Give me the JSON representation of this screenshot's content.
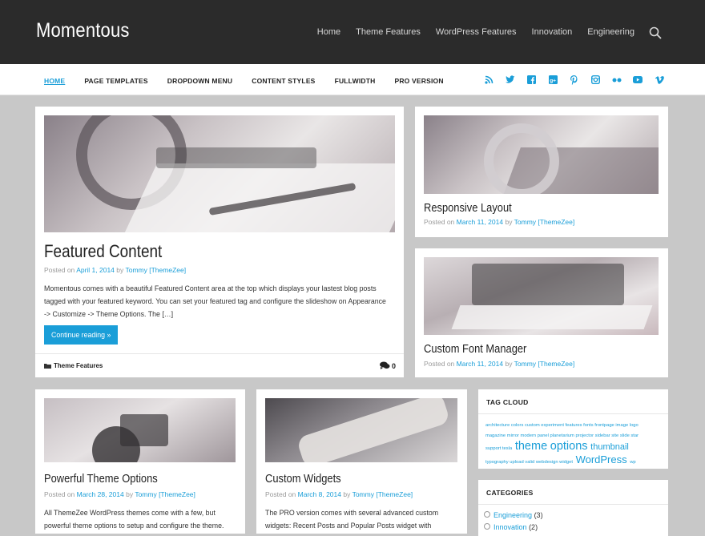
{
  "site": {
    "title": "Momentous"
  },
  "top_nav": [
    "Home",
    "Theme Features",
    "WordPress Features",
    "Innovation",
    "Engineering"
  ],
  "main_nav": [
    "HOME",
    "PAGE TEMPLATES",
    "DROPDOWN MENU",
    "CONTENT STYLES",
    "FULLWIDTH",
    "PRO VERSION"
  ],
  "social_icons": [
    "rss-icon",
    "twitter-icon",
    "facebook-icon",
    "google-plus-icon",
    "pinterest-icon",
    "instagram-icon",
    "flickr-icon",
    "youtube-icon",
    "vimeo-icon"
  ],
  "featured": {
    "title": "Featured Content",
    "posted_on": "Posted on",
    "date": "April 1, 2014",
    "by": "by",
    "author": "Tommy [ThemeZee]",
    "excerpt": "Momentous comes with a beautiful Featured Content area at the top which displays your lastest blog posts tagged with your featured keyword. You can set your featured tag and configure the slideshow on Appearance -> Customize -> Theme Options. The […]",
    "button": "Continue reading »",
    "category": "Theme Features",
    "comments": "0"
  },
  "side_posts": [
    {
      "title": "Responsive Layout",
      "posted_on": "Posted on",
      "date": "March 11, 2014",
      "by": "by",
      "author": "Tommy [ThemeZee]"
    },
    {
      "title": "Custom Font Manager",
      "posted_on": "Posted on",
      "date": "March 11, 2014",
      "by": "by",
      "author": "Tommy [ThemeZee]"
    }
  ],
  "bottom_posts": [
    {
      "title": "Powerful Theme Options",
      "posted_on": "Posted on",
      "date": "March 28, 2014",
      "by": "by",
      "author": "Tommy [ThemeZee]",
      "excerpt": "All ThemeZee WordPress themes come with a few, but powerful theme options to setup and configure the theme."
    },
    {
      "title": "Custom Widgets",
      "posted_on": "Posted on",
      "date": "March 8, 2014",
      "by": "by",
      "author": "Tommy [ThemeZee]",
      "excerpt": "The PRO version comes with several advanced custom widgets: Recent Posts and Popular Posts widget with"
    }
  ],
  "widgets": {
    "tag_cloud_title": "TAG CLOUD",
    "tags_small_1": "architecture colors custom experiment features fonts frontpage image logo magazine mirror modern panel planetarium projector sidebar site slide star support tesla",
    "tag_theme": "theme",
    "tag_options": "options",
    "tag_thumbnail": "thumbnail",
    "tags_small_2": "typography upload valid webdesign widget",
    "tag_wordpress": "WordPress",
    "tag_wp": "wp",
    "categories_title": "CATEGORIES",
    "categories": [
      {
        "name": "Engineering",
        "count": "(3)"
      },
      {
        "name": "Innovation",
        "count": "(2)"
      }
    ]
  }
}
